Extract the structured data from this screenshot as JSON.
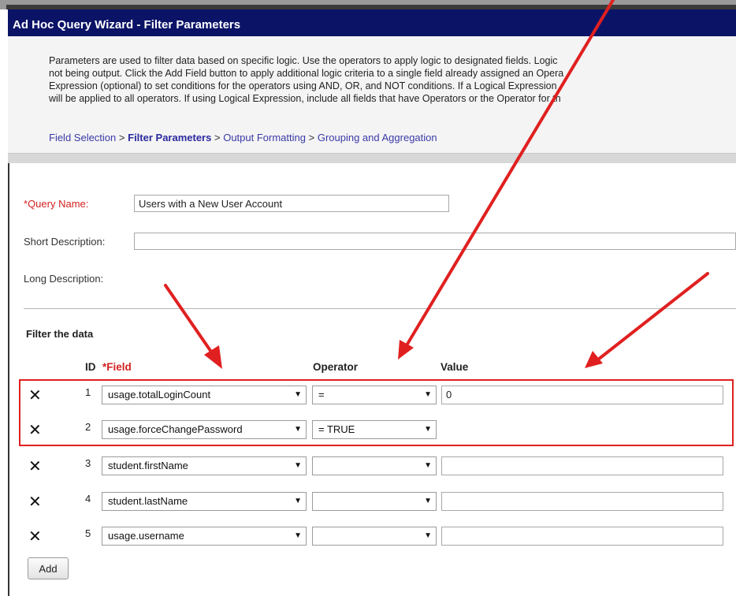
{
  "window": {
    "title": "Ad Hoc Query Wizard - Filter Parameters"
  },
  "intro": {
    "lines": [
      "Parameters are used to filter data based on specific logic. Use the operators to apply logic to designated fields. Logic",
      "not being output. Click the Add Field button to apply additional logic criteria to a single field already assigned an Opera",
      "Expression (optional) to set conditions for the operators using AND, OR, and NOT conditions. If a Logical Expression",
      "will be applied to all operators. If using Logical Expression, include all fields that have Operators or the Operator for th"
    ]
  },
  "breadcrumb": {
    "items": [
      "Field Selection",
      "Filter Parameters",
      "Output Formatting",
      "Grouping and Aggregation"
    ],
    "separator": ">",
    "current_index": 1
  },
  "form": {
    "query_name": {
      "required_mark": "*",
      "label": "Query Name:",
      "value": "Users with a New User Account"
    },
    "short_description": {
      "label": "Short Description:",
      "value": ""
    },
    "long_description": {
      "label": "Long Description:"
    }
  },
  "filter": {
    "heading": "Filter the data",
    "columns": {
      "id": "ID",
      "field_required_mark": "*",
      "field": "Field",
      "operator": "Operator",
      "value": "Value"
    },
    "rows": [
      {
        "id": "1",
        "field": "usage.totalLoginCount",
        "operator": "=",
        "value": "0",
        "has_value_input": true
      },
      {
        "id": "2",
        "field": "usage.forceChangePassword",
        "operator": "= TRUE",
        "value": "",
        "has_value_input": false
      },
      {
        "id": "3",
        "field": "student.firstName",
        "operator": "",
        "value": "",
        "has_value_input": true
      },
      {
        "id": "4",
        "field": "student.lastName",
        "operator": "",
        "value": "",
        "has_value_input": true
      },
      {
        "id": "5",
        "field": "usage.username",
        "operator": "",
        "value": "",
        "has_value_input": true
      }
    ],
    "delete_glyph": "✕",
    "dropdown_glyph": "▼",
    "add_button": "Add"
  },
  "annotation": {
    "arrow_color": "#e02020",
    "highlight_color": "#e02020"
  },
  "colors": {
    "title_bar": "#0b1367",
    "required": "#d42020",
    "link": "#3a3aa8"
  }
}
